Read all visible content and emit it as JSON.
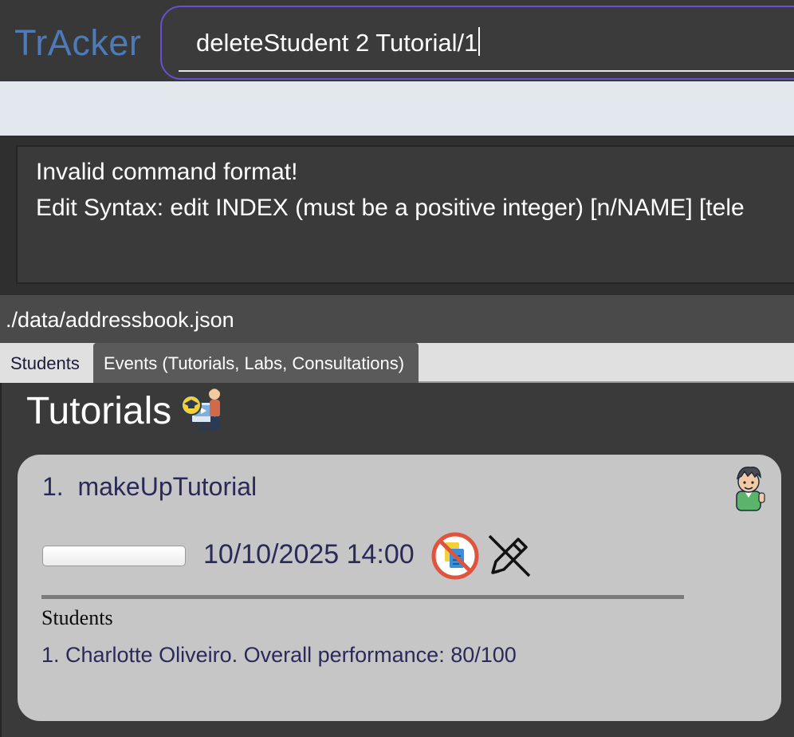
{
  "app": {
    "title": "TrAcker"
  },
  "command": {
    "value": "deleteStudent 2 Tutorial/1"
  },
  "result": {
    "line1": "Invalid command format!",
    "line2": "Edit Syntax: edit INDEX (must be a positive integer) [n/NAME] [tele"
  },
  "status": {
    "path": "./data/addressbook.json"
  },
  "tabs": [
    {
      "label": "Students",
      "selected": false
    },
    {
      "label": "Events (Tutorials, Labs, Consultations)",
      "selected": true
    }
  ],
  "page": {
    "title": "Tutorials",
    "title_icon": "teacher-presentation-icon"
  },
  "events": [
    {
      "index": "1.",
      "name": "makeUpTutorial",
      "datetime": "10/10/2025 14:00",
      "progress": 0,
      "icons": [
        "avatar-icon",
        "no-document-icon",
        "no-edit-icon"
      ],
      "students_heading": "Students",
      "students": [
        "1. Charlotte Oliveiro. Overall performance: 80/100"
      ]
    }
  ],
  "colors": {
    "accent": "#4d7ab8",
    "command_border": "#6a50d0",
    "card_bg": "#c6c6c6",
    "card_text": "#2a2a5a",
    "no_icon_red": "#e0533d"
  }
}
